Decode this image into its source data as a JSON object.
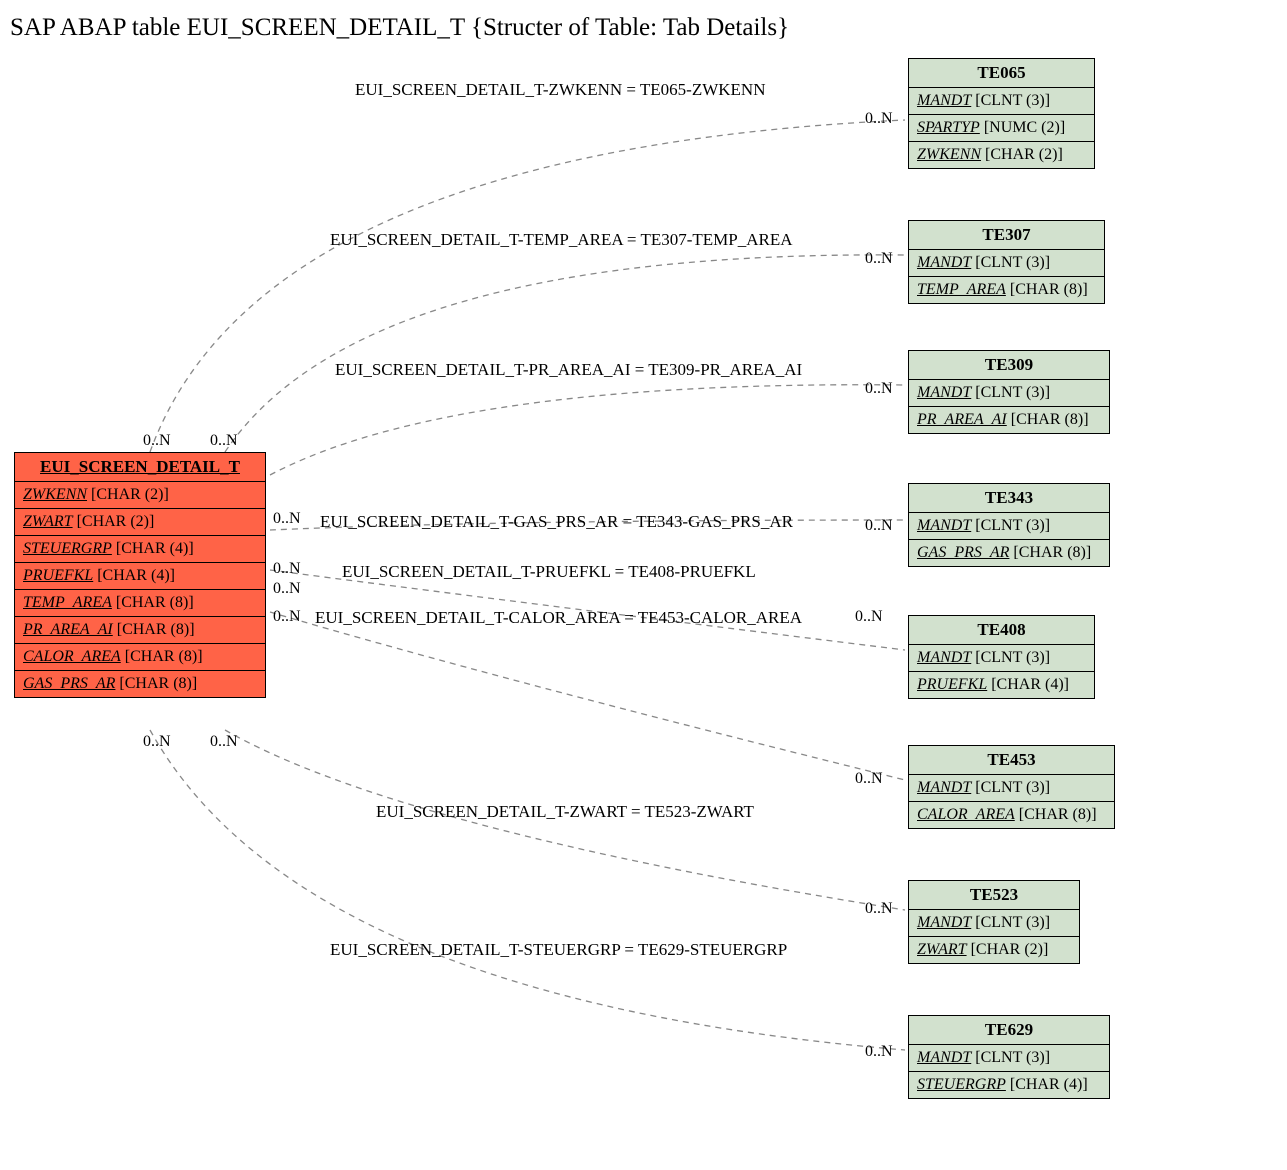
{
  "title": "SAP ABAP table EUI_SCREEN_DETAIL_T {Structer of Table: Tab Details}",
  "main": {
    "name": "EUI_SCREEN_DETAIL_T",
    "fields": [
      {
        "n": "ZWKENN",
        "t": "[CHAR (2)]"
      },
      {
        "n": "ZWART",
        "t": "[CHAR (2)]"
      },
      {
        "n": "STEUERGRP",
        "t": "[CHAR (4)]"
      },
      {
        "n": "PRUEFKL",
        "t": "[CHAR (4)]"
      },
      {
        "n": "TEMP_AREA",
        "t": "[CHAR (8)]"
      },
      {
        "n": "PR_AREA_AI",
        "t": "[CHAR (8)]"
      },
      {
        "n": "CALOR_AREA",
        "t": "[CHAR (8)]"
      },
      {
        "n": "GAS_PRS_AR",
        "t": "[CHAR (8)]"
      }
    ]
  },
  "related": [
    {
      "name": "TE065",
      "fields": [
        {
          "n": "MANDT",
          "t": "[CLNT (3)]"
        },
        {
          "n": "SPARTYP",
          "t": "[NUMC (2)]"
        },
        {
          "n": "ZWKENN",
          "t": "[CHAR (2)]"
        }
      ]
    },
    {
      "name": "TE307",
      "fields": [
        {
          "n": "MANDT",
          "t": "[CLNT (3)]"
        },
        {
          "n": "TEMP_AREA",
          "t": "[CHAR (8)]"
        }
      ]
    },
    {
      "name": "TE309",
      "fields": [
        {
          "n": "MANDT",
          "t": "[CLNT (3)]"
        },
        {
          "n": "PR_AREA_AI",
          "t": "[CHAR (8)]"
        }
      ]
    },
    {
      "name": "TE343",
      "fields": [
        {
          "n": "MANDT",
          "t": "[CLNT (3)]"
        },
        {
          "n": "GAS_PRS_AR",
          "t": "[CHAR (8)]"
        }
      ]
    },
    {
      "name": "TE408",
      "fields": [
        {
          "n": "MANDT",
          "t": "[CLNT (3)]"
        },
        {
          "n": "PRUEFKL",
          "t": "[CHAR (4)]"
        }
      ]
    },
    {
      "name": "TE453",
      "fields": [
        {
          "n": "MANDT",
          "t": "[CLNT (3)]"
        },
        {
          "n": "CALOR_AREA",
          "t": "[CHAR (8)]"
        }
      ]
    },
    {
      "name": "TE523",
      "fields": [
        {
          "n": "MANDT",
          "t": "[CLNT (3)]"
        },
        {
          "n": "ZWART",
          "t": "[CHAR (2)]"
        }
      ]
    },
    {
      "name": "TE629",
      "fields": [
        {
          "n": "MANDT",
          "t": "[CLNT (3)]"
        },
        {
          "n": "STEUERGRP",
          "t": "[CHAR (4)]"
        }
      ]
    }
  ],
  "relations": [
    "EUI_SCREEN_DETAIL_T-ZWKENN = TE065-ZWKENN",
    "EUI_SCREEN_DETAIL_T-TEMP_AREA = TE307-TEMP_AREA",
    "EUI_SCREEN_DETAIL_T-PR_AREA_AI = TE309-PR_AREA_AI",
    "EUI_SCREEN_DETAIL_T-GAS_PRS_AR = TE343-GAS_PRS_AR",
    "EUI_SCREEN_DETAIL_T-PRUEFKL = TE408-PRUEFKL",
    "EUI_SCREEN_DETAIL_T-CALOR_AREA = TE453-CALOR_AREA",
    "EUI_SCREEN_DETAIL_T-ZWART = TE523-ZWART",
    "EUI_SCREEN_DETAIL_T-STEUERGRP = TE629-STEUERGRP"
  ],
  "card": "0..N"
}
